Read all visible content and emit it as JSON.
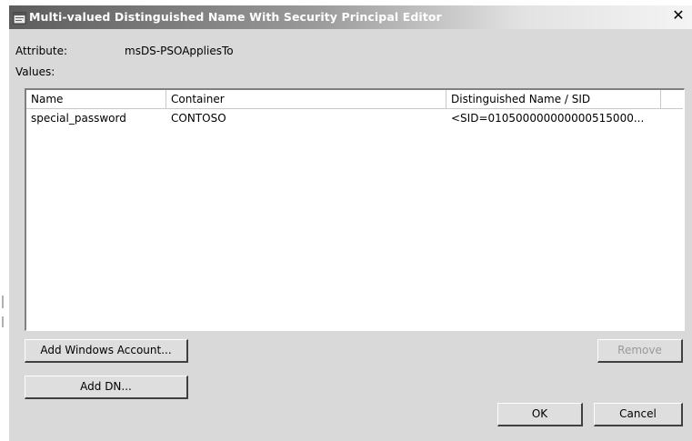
{
  "window": {
    "title": "Multi-valued Distinguished Name With Security Principal Editor",
    "close_label": "✕"
  },
  "form": {
    "attribute_label": "Attribute:",
    "attribute_value": "msDS-PSOAppliesTo",
    "values_label": "Values:"
  },
  "list": {
    "columns": [
      "Name",
      "Container",
      "Distinguished Name / SID"
    ],
    "rows": [
      {
        "name": "special_password",
        "container": "CONTOSO",
        "dn": "<SID=010500000000000515000..."
      }
    ]
  },
  "buttons": {
    "add_windows_account": "Add Windows Account...",
    "add_dn": "Add DN...",
    "remove": "Remove",
    "ok": "OK",
    "cancel": "Cancel"
  }
}
